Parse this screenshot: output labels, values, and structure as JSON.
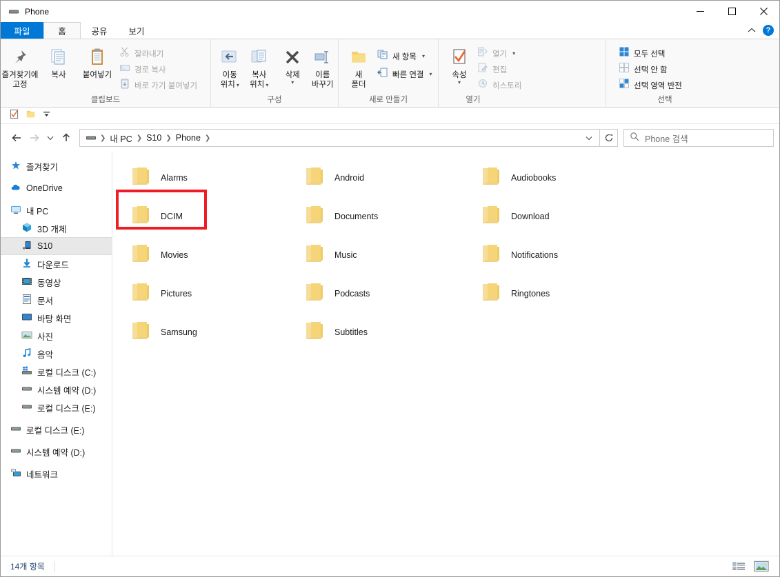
{
  "window": {
    "title": "Phone",
    "icon": "device-phone-icon",
    "controls": {
      "minimize": "─",
      "maximize": "☐",
      "close": "✕"
    }
  },
  "ribbon": {
    "tabs": [
      {
        "label": "파일",
        "type": "file"
      },
      {
        "label": "홈",
        "type": "active"
      },
      {
        "label": "공유",
        "type": "normal"
      },
      {
        "label": "보기",
        "type": "normal"
      }
    ],
    "collapse_icon": "chevron-up-icon",
    "help_label": "?",
    "groups": [
      {
        "name": "clipboard",
        "label": "클립보드",
        "big_buttons": [
          {
            "label_line1": "즐겨찾기에",
            "label_line2": "고정",
            "icon": "pin-icon"
          },
          {
            "label_line1": "복사",
            "label_line2": "",
            "icon": "copy-icon"
          },
          {
            "label_line1": "붙여넣기",
            "label_line2": "",
            "icon": "paste-icon"
          }
        ],
        "small_buttons": [
          {
            "label": "잘라내기",
            "icon": "scissors-icon",
            "disabled": true
          },
          {
            "label": "경로 복사",
            "icon": "copy-path-icon",
            "disabled": true
          },
          {
            "label": "바로 가기 붙여넣기",
            "icon": "paste-shortcut-icon",
            "disabled": true
          }
        ]
      },
      {
        "name": "organize",
        "label": "구성",
        "big_buttons": [
          {
            "label_line1": "이동",
            "label_line2": "위치",
            "icon": "move-to-icon",
            "caret": true
          },
          {
            "label_line1": "복사",
            "label_line2": "위치",
            "icon": "copy-to-icon",
            "caret": true
          },
          {
            "label_line1": "삭제",
            "label_line2": "",
            "icon": "delete-x-icon",
            "caret": true
          },
          {
            "label_line1": "이름",
            "label_line2": "바꾸기",
            "icon": "rename-icon"
          }
        ],
        "small_buttons": []
      },
      {
        "name": "new",
        "label": "새로 만들기",
        "big_buttons": [
          {
            "label_line1": "새",
            "label_line2": "폴더",
            "icon": "new-folder-icon"
          }
        ],
        "small_buttons": [
          {
            "label": "새 항목",
            "icon": "new-item-icon",
            "caret": true
          },
          {
            "label": "빠른 연결",
            "icon": "easy-access-icon",
            "caret": true
          }
        ]
      },
      {
        "name": "open",
        "label": "열기",
        "big_buttons": [
          {
            "label_line1": "속성",
            "label_line2": "",
            "icon": "properties-icon",
            "caret": true
          }
        ],
        "small_buttons": [
          {
            "label": "열기",
            "icon": "open-icon",
            "caret": true,
            "disabled": true
          },
          {
            "label": "편집",
            "icon": "edit-icon",
            "disabled": true
          },
          {
            "label": "히스토리",
            "icon": "history-icon",
            "disabled": true
          }
        ]
      },
      {
        "name": "select",
        "label": "선택",
        "big_buttons": [],
        "small_buttons": [
          {
            "label": "모두 선택",
            "icon": "select-all-icon"
          },
          {
            "label": "선택 안 함",
            "icon": "select-none-icon"
          },
          {
            "label": "선택 영역 반전",
            "icon": "invert-selection-icon"
          }
        ]
      }
    ]
  },
  "quick_access": {
    "items": [
      {
        "icon": "properties-small-icon"
      },
      {
        "icon": "new-folder-small-icon"
      },
      {
        "icon": "customize-qat-dropdown-icon"
      }
    ]
  },
  "address_bar": {
    "back_icon": "arrow-left-icon",
    "forward_icon": "arrow-right-icon",
    "recent_icon": "chevron-down-icon",
    "up_icon": "arrow-up-icon",
    "path_icon": "device-phone-icon",
    "breadcrumbs": [
      "내 PC",
      "S10",
      "Phone"
    ],
    "dropdown_icon": "chevron-down-icon",
    "refresh_icon": "refresh-icon",
    "search": {
      "icon": "search-icon",
      "placeholder": "Phone 검색",
      "value": ""
    }
  },
  "nav_pane": {
    "items": [
      {
        "label": "즐겨찾기",
        "icon": "star-favorites-icon",
        "indent": "root",
        "selected": false,
        "gap_before": false
      },
      {
        "label": "OneDrive",
        "icon": "onedrive-cloud-icon",
        "indent": "root",
        "selected": false,
        "gap_before": true
      },
      {
        "label": "내 PC",
        "icon": "this-pc-icon",
        "indent": "root",
        "selected": false,
        "gap_before": true
      },
      {
        "label": "3D 개체",
        "icon": "3d-objects-icon",
        "indent": "child",
        "selected": false,
        "gap_before": false
      },
      {
        "label": "S10",
        "icon": "phone-device-icon",
        "indent": "child",
        "selected": true,
        "gap_before": false
      },
      {
        "label": "다운로드",
        "icon": "downloads-icon",
        "indent": "child",
        "selected": false,
        "gap_before": false
      },
      {
        "label": "동영상",
        "icon": "videos-icon",
        "indent": "child",
        "selected": false,
        "gap_before": false
      },
      {
        "label": "문서",
        "icon": "documents-icon",
        "indent": "child",
        "selected": false,
        "gap_before": false
      },
      {
        "label": "바탕 화면",
        "icon": "desktop-icon",
        "indent": "child",
        "selected": false,
        "gap_before": false
      },
      {
        "label": "사진",
        "icon": "pictures-icon",
        "indent": "child",
        "selected": false,
        "gap_before": false
      },
      {
        "label": "음악",
        "icon": "music-icon",
        "indent": "child",
        "selected": false,
        "gap_before": false
      },
      {
        "label": "로컬 디스크 (C:)",
        "icon": "windows-drive-icon",
        "indent": "child",
        "selected": false,
        "gap_before": false
      },
      {
        "label": "시스템 예약 (D:)",
        "icon": "drive-icon",
        "indent": "child",
        "selected": false,
        "gap_before": false
      },
      {
        "label": "로컬 디스크 (E:)",
        "icon": "drive-icon",
        "indent": "child",
        "selected": false,
        "gap_before": false
      },
      {
        "label": "로컬 디스크 (E:)",
        "icon": "drive-icon",
        "indent": "root",
        "selected": false,
        "gap_before": true
      },
      {
        "label": "시스템 예약 (D:)",
        "icon": "drive-icon",
        "indent": "root",
        "selected": false,
        "gap_before": true
      },
      {
        "label": "네트워크",
        "icon": "network-icon",
        "indent": "root",
        "selected": false,
        "gap_before": true
      }
    ]
  },
  "files": {
    "items": [
      {
        "name": "Alarms",
        "icon": "folder-icon",
        "highlighted": false
      },
      {
        "name": "Android",
        "icon": "folder-icon",
        "highlighted": false
      },
      {
        "name": "Audiobooks",
        "icon": "folder-icon",
        "highlighted": false
      },
      {
        "name": "DCIM",
        "icon": "folder-icon",
        "highlighted": true
      },
      {
        "name": "Documents",
        "icon": "folder-icon",
        "highlighted": false
      },
      {
        "name": "Download",
        "icon": "folder-icon",
        "highlighted": false
      },
      {
        "name": "Movies",
        "icon": "folder-icon",
        "highlighted": false
      },
      {
        "name": "Music",
        "icon": "folder-icon",
        "highlighted": false
      },
      {
        "name": "Notifications",
        "icon": "folder-icon",
        "highlighted": false
      },
      {
        "name": "Pictures",
        "icon": "folder-icon",
        "highlighted": false
      },
      {
        "name": "Podcasts",
        "icon": "folder-icon",
        "highlighted": false
      },
      {
        "name": "Ringtones",
        "icon": "folder-icon",
        "highlighted": false
      },
      {
        "name": "Samsung",
        "icon": "folder-icon",
        "highlighted": false
      },
      {
        "name": "Subtitles",
        "icon": "folder-icon",
        "highlighted": false
      }
    ],
    "highlight_color": "#ee1c25"
  },
  "status_bar": {
    "item_count_text": "14개 항목",
    "view_buttons": [
      {
        "icon": "details-view-icon",
        "active": false
      },
      {
        "icon": "large-icons-view-icon",
        "active": true
      }
    ]
  },
  "colors": {
    "accent": "#0078d7",
    "ribbon_bg": "#f9f9f9",
    "folder_yellow": "#f5d578",
    "selection_gray": "#e8e8e8",
    "highlight_red": "#ee1c25"
  }
}
